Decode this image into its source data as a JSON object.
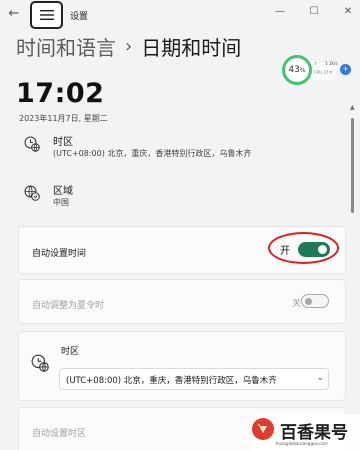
{
  "window": {
    "title": "设置"
  },
  "breadcrumb": {
    "parent": "时间和语言",
    "separator": "›",
    "current": "日期和时间"
  },
  "widget": {
    "percent": "43",
    "percent_unit": "%",
    "net": "3.1K/s",
    "cpu": "CPU 47℃",
    "dot": "+"
  },
  "clock": {
    "time": "17:02",
    "date": "2023年11月7日, 星期二"
  },
  "timezone_info": {
    "title": "时区",
    "value": "(UTC+08:00) 北京，重庆，香港特别行政区，乌鲁木齐"
  },
  "region_info": {
    "title": "区域",
    "value": "中国"
  },
  "auto_time": {
    "label": "自动设置时间",
    "state_text": "开",
    "on": true
  },
  "dst": {
    "label": "自动调整为夏令时",
    "state_text": "关",
    "on": false,
    "disabled": true
  },
  "timezone_select": {
    "label": "时区",
    "value": "(UTC+08:00) 北京，重庆，香港特别行政区，乌鲁木齐"
  },
  "auto_timezone": {
    "label": "自动设置时区",
    "disabled": true
  },
  "watermark": {
    "name": "百香果号",
    "url": "huanglinbaixiangguo.com"
  },
  "colors": {
    "accent": "#1e7a55",
    "highlight": "#e02020",
    "ring": "#3ec66e"
  }
}
